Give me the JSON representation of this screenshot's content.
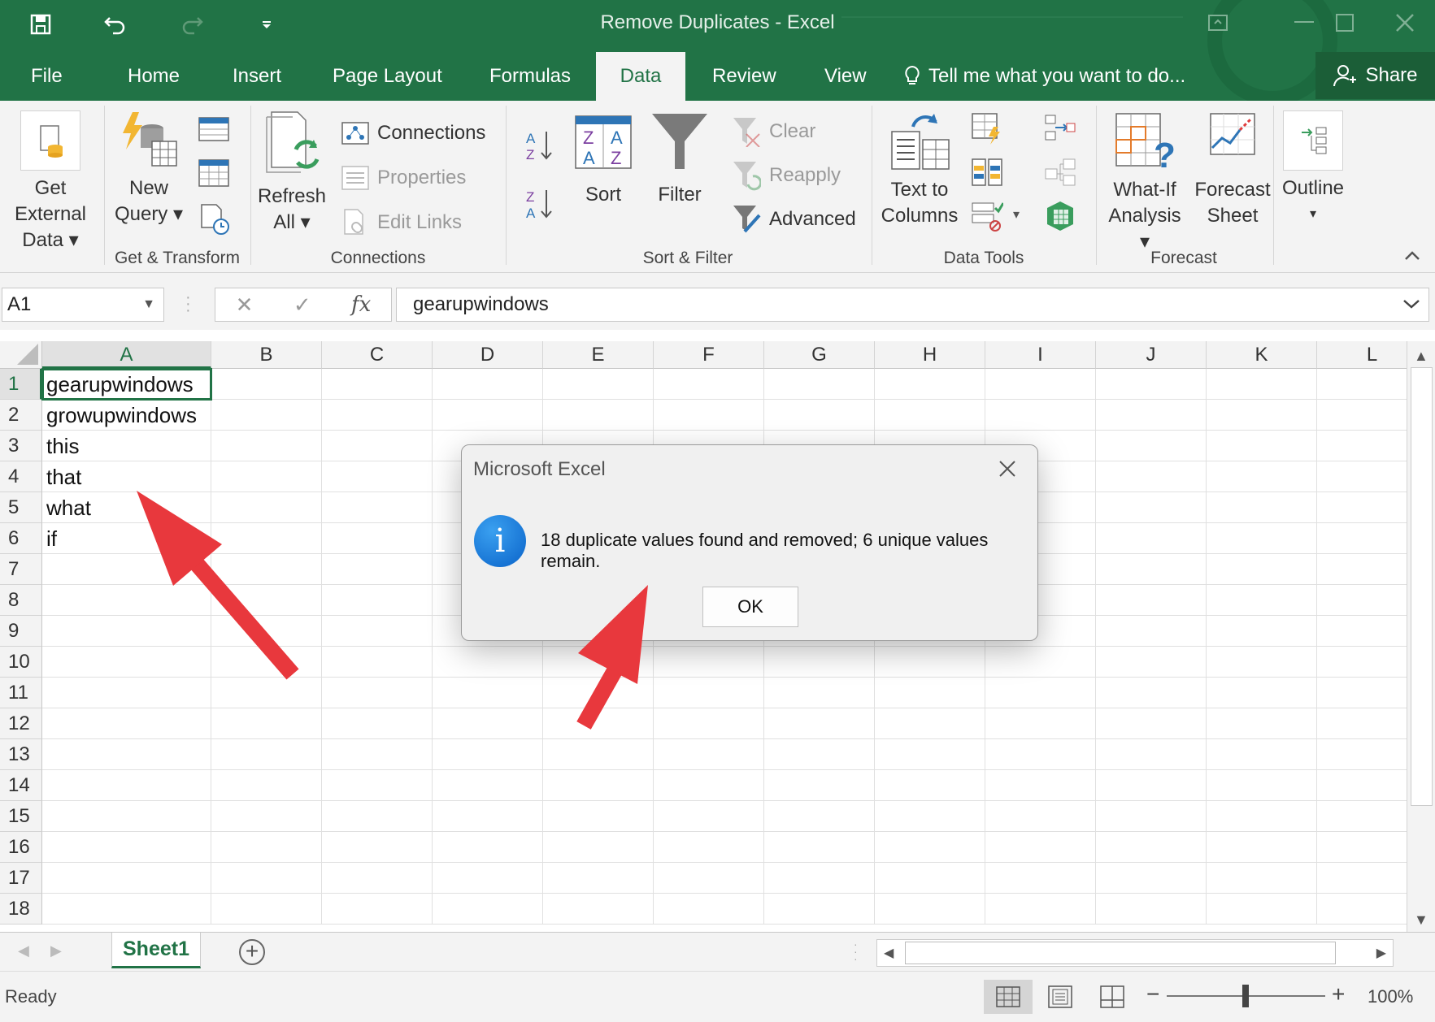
{
  "window": {
    "title": "Remove Duplicates - Excel"
  },
  "tabs": [
    {
      "label": "File"
    },
    {
      "label": "Home"
    },
    {
      "label": "Insert"
    },
    {
      "label": "Page Layout"
    },
    {
      "label": "Formulas"
    },
    {
      "label": "Data",
      "active": true
    },
    {
      "label": "Review"
    },
    {
      "label": "View"
    }
  ],
  "tellme": "Tell me what you want to do...",
  "share": "Share",
  "ribbon": {
    "get_external": [
      "Get External",
      "Data ▾"
    ],
    "new_query": [
      "New",
      "Query ▾"
    ],
    "group_get_transform": "Get & Transform",
    "refresh_all": [
      "Refresh",
      "All ▾"
    ],
    "connections": "Connections",
    "properties": "Properties",
    "edit_links": "Edit Links",
    "group_connections": "Connections",
    "sort": "Sort",
    "filter": "Filter",
    "clear": "Clear",
    "reapply": "Reapply",
    "advanced": "Advanced",
    "group_sort_filter": "Sort & Filter",
    "text_to_columns": [
      "Text to",
      "Columns"
    ],
    "group_data_tools": "Data Tools",
    "what_if": [
      "What-If",
      "Analysis ▾"
    ],
    "forecast_sheet": [
      "Forecast",
      "Sheet"
    ],
    "group_forecast": "Forecast",
    "outline": [
      "Outline",
      "▾"
    ]
  },
  "formula_bar": {
    "name_box": "A1",
    "formula": "gearupwindows"
  },
  "columns": [
    "A",
    "B",
    "C",
    "D",
    "E",
    "F",
    "G",
    "H",
    "I",
    "J",
    "K",
    "L"
  ],
  "rows": [
    "1",
    "2",
    "3",
    "4",
    "5",
    "6",
    "7",
    "8",
    "9",
    "10",
    "11",
    "12",
    "13",
    "14",
    "15",
    "16",
    "17",
    "18"
  ],
  "cells_A": [
    "gearupwindows",
    "growupwindows",
    "this",
    "that",
    "what",
    "if"
  ],
  "sheet": {
    "tab": "Sheet1",
    "add": "+"
  },
  "status": {
    "ready": "Ready",
    "zoom": "100%"
  },
  "dialog": {
    "title": "Microsoft Excel",
    "message": "18 duplicate values found and removed; 6 unique values remain.",
    "ok": "OK",
    "icon": "i"
  },
  "colors": {
    "excel_green": "#217346",
    "annotation_red": "#e8383d"
  }
}
